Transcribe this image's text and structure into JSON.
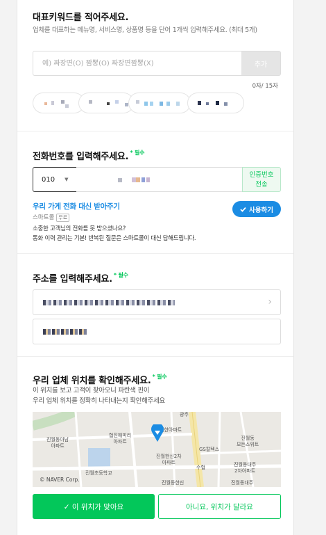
{
  "keyword": {
    "title": "대표키워드를 적어주세요.",
    "description": "업체를 대표하는 메뉴명, 서비스명, 상품명 등을 단어 1개씩 입력해주세요. (최대 5개)",
    "placeholder": "예) 짜장면(O) 짬뽕(O) 짜장면짬뽕(X)",
    "add_label": "추가",
    "counter": "0자/ 15자"
  },
  "phone": {
    "title": "전화번호를 입력해주세요.",
    "required": "* 필수",
    "country_code": "010",
    "verify_label": "인증번호\n전송",
    "delegate_link": "우리 가게 전화 대신 받아주기",
    "smartcall": "스마트콜",
    "smartcall_tag": "무료",
    "use_button": "사용하기",
    "desc_line1": "소중한 고객님의 전화를 못 받으셨나요?",
    "desc_line2": "통화 이력 관리는 기본! 반복된 질문은 스마트콜이 대신 답해드립니다."
  },
  "address": {
    "title": "주소를 입력해주세요.",
    "required": "* 필수"
  },
  "location": {
    "title": "우리 업체 위치를 확인해주세요.",
    "required": "* 필수",
    "desc_line1": "이 위치를 보고 고객이 찾아오니 파란색 핀이",
    "desc_line2": "우리 업체 위치를 정확히 나타내는지 확인해주세요",
    "map_credit": "© NAVER Corp.",
    "map_labels": {
      "poi1": "진월동아남\n아파트",
      "poi2": "협진해피리\n아파트",
      "poi3": "세한아파트",
      "poi4": "GS칼텍스",
      "poi5": "진월동\n모든스위트",
      "poi6": "진월동대주\n2차아파트",
      "poi7": "진월한신2차\n아파트",
      "poi8": "진월초등학교",
      "poi9": "진월동한신",
      "poi10": "진월동대주",
      "poi11": "수협",
      "poi12": "광주"
    },
    "yes_label": "✓ 이 위치가 맞아요",
    "no_label": "아니요, 위치가 달라요"
  },
  "colors": {
    "accent": "#03c75a",
    "link": "#1b8ce3",
    "pin": "#1b8ce3"
  }
}
